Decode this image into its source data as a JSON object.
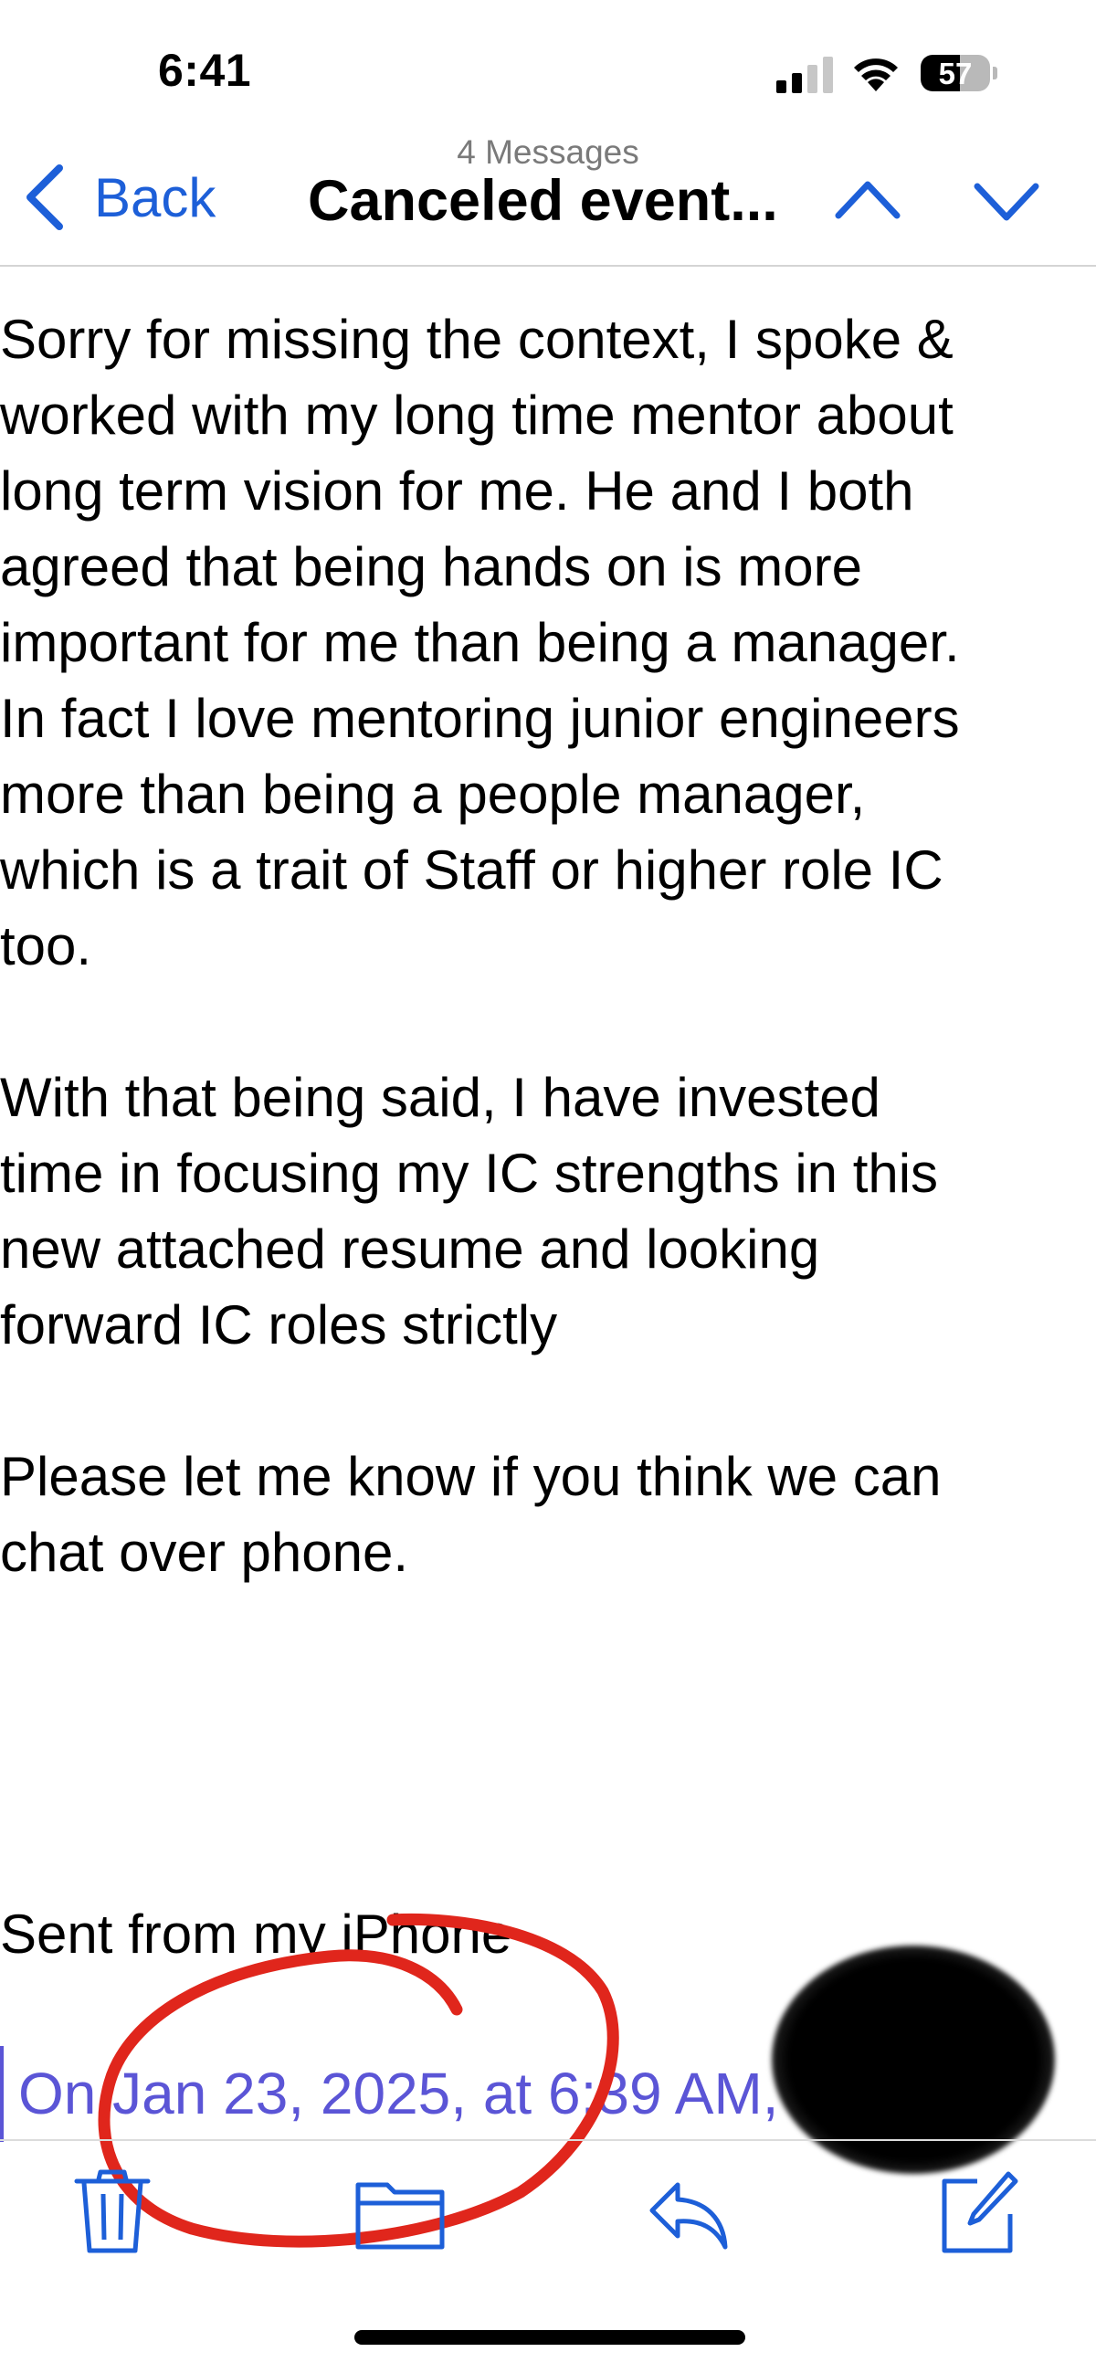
{
  "status_bar": {
    "time": "6:41",
    "battery_percent": "57",
    "battery_level": 0.57,
    "icons": [
      "cellular-signal-icon",
      "wifi-icon",
      "battery-icon"
    ]
  },
  "nav": {
    "back_label": "Back",
    "message_count": "4 Messages",
    "thread_title": "Canceled event...",
    "icons": [
      "chevron-left-icon",
      "chevron-up-icon",
      "chevron-down-icon"
    ]
  },
  "message": {
    "paragraph_1": "Sorry for missing the context, I spoke &\nworked with my long time mentor about\nlong term vision for me. He and I both\nagreed that being hands on is more\nimportant for me than being a manager.\nIn fact I love mentoring junior engineers\nmore than being a people manager,\nwhich is a trait of Staff or higher role IC\ntoo.",
    "paragraph_2": "With that being said, I have invested\ntime in focusing my IC strengths in this\nnew attached resume and looking\nforward IC roles strictly",
    "paragraph_3": "Please let me know if you think we can\nchat over phone.",
    "signature": "Sent from my iPhone",
    "quoted_header": "On Jan 23, 2025, at 6:39 AM,"
  },
  "toolbar": {
    "icons": [
      "trash-icon",
      "folder-icon",
      "reply-icon",
      "compose-icon"
    ]
  },
  "colors": {
    "accent": "#1d5fd8",
    "quote": "#5b55d6",
    "annotation": "#e0261c"
  }
}
